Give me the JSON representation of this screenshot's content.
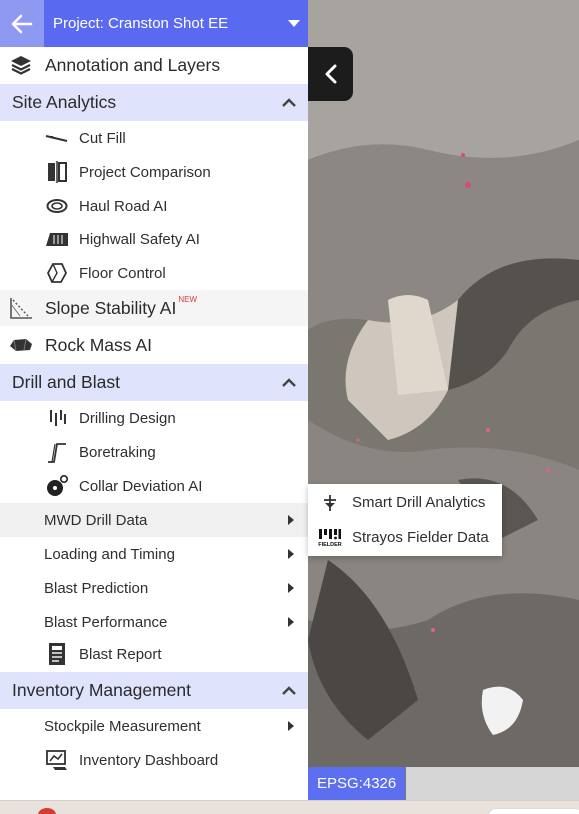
{
  "header": {
    "project_label": "Project: Cranston Shot EE"
  },
  "menu": {
    "annotation": "Annotation and Layers",
    "site_analytics": {
      "title": "Site Analytics",
      "items": [
        "Cut Fill",
        "Project Comparison",
        "Haul Road AI",
        "Highwall Safety AI",
        "Floor Control"
      ]
    },
    "slope_stability": "Slope Stability AI",
    "new_badge": "NEW",
    "rock_mass": "Rock Mass AI",
    "drill_blast": {
      "title": "Drill and Blast",
      "items": [
        "Drilling Design",
        "Boretraking",
        "Collar Deviation AI"
      ],
      "submenus": [
        "MWD Drill Data",
        "Loading and Timing",
        "Blast Prediction",
        "Blast Performance"
      ],
      "report": "Blast Report"
    },
    "inventory": {
      "title": "Inventory Management",
      "stockpile": "Stockpile Measurement",
      "dashboard": "Inventory Dashboard"
    }
  },
  "flyout": {
    "items": [
      "Smart Drill Analytics",
      "Strayos Fielder Data"
    ],
    "fielder_logo_text": "FIELDER"
  },
  "map": {
    "epsg": "EPSG:4326"
  },
  "colors": {
    "accent": "#5a6af0",
    "section_bg": "#dfe3fb",
    "new_badge": "#e03a3a"
  },
  "icons": [
    "back-arrow-icon",
    "caret-down-icon",
    "layers-icon",
    "chevron-up-icon",
    "cut-fill-icon",
    "project-comparison-icon",
    "haul-road-icon",
    "highwall-icon",
    "floor-control-icon",
    "slope-icon",
    "rock-mass-icon",
    "drilling-design-icon",
    "boretraking-icon",
    "collar-deviation-icon",
    "blast-report-icon",
    "inventory-dashboard-icon",
    "smart-drill-icon",
    "fielder-logo-icon",
    "collapse-chevron-icon"
  ]
}
